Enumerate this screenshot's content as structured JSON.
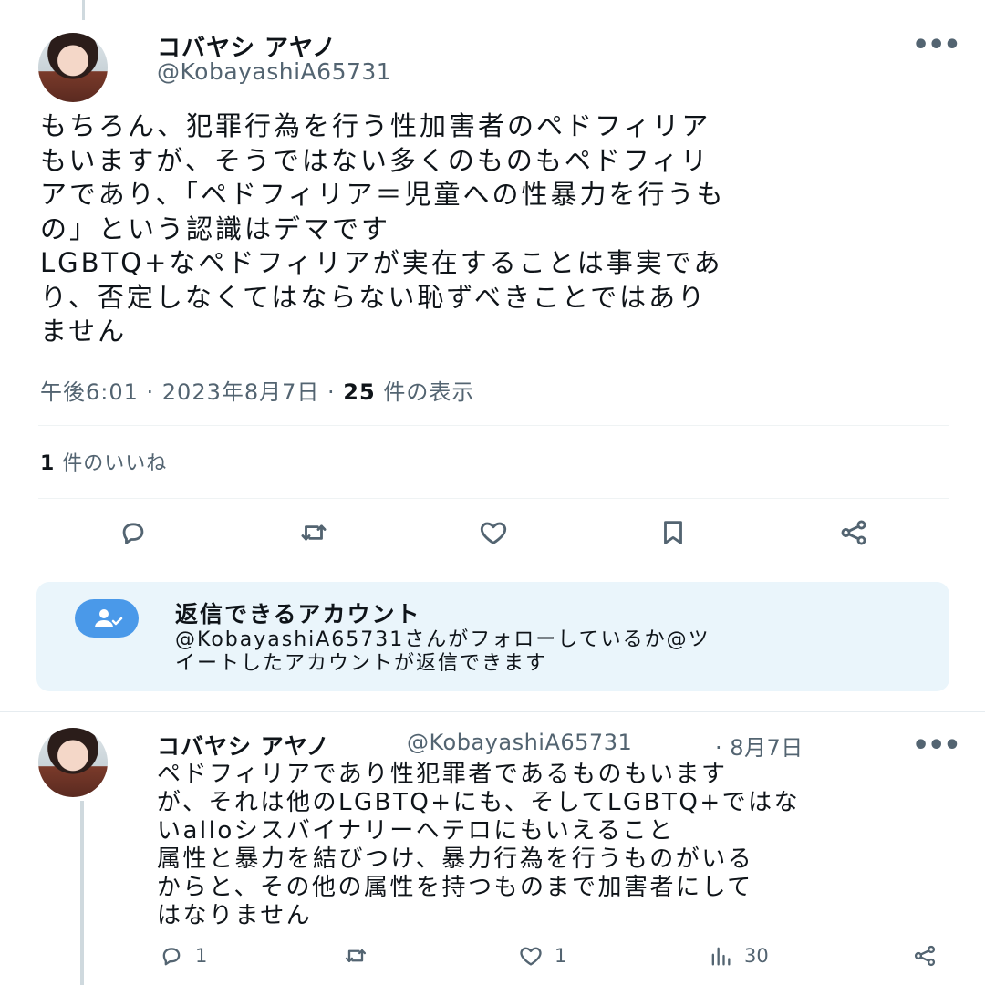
{
  "tweet": {
    "author_name": "コバヤシ アヤノ",
    "author_handle": "@KobayashiA65731",
    "more_label": "•••",
    "text": "もちろん、犯罪行為を行う性加害者のペドフィリア\nもいますが、そうではない多くのものもペドフィリ\nアであり、「ペドフィリア＝児童への性暴力を行うも\nの」という認識はデマです\nLGBTQ+なペドフィリアが実在することは事実であ\nり、否定しなくてはならない恥ずべきことではあり\nません",
    "time": "午後6:01 · 2023年8月7日 · ",
    "views_count": "25",
    "views_label": " 件の表示",
    "likes_count": "1",
    "likes_label": " 件のいいね"
  },
  "actions": {
    "reply": "reply-icon",
    "retweet": "retweet-icon",
    "like": "heart-icon",
    "bookmark": "bookmark-icon",
    "share": "share-icon"
  },
  "reply_notice": {
    "title": "返信できるアカウント",
    "body": "@KobayashiA65731さんがフォローしているか@ツ\nイートしたアカウントが返信できます"
  },
  "reply": {
    "author_name": "コバヤシ アヤノ",
    "author_handle": "@KobayashiA65731",
    "date": "· 8月7日",
    "more_label": "•••",
    "text": "ペドフィリアであり性犯罪者であるものもいます\nが、それは他のLGBTQ+にも、そしてLGBTQ+ではな\nいalloシスバイナリーヘテロにもいえること\n属性と暴力を結びつけ、暴力行為を行うものがいる\nからと、その他の属性を持つものまで加害者にして\nはなりません",
    "reply_count": "1",
    "retweet_count": "",
    "like_count": "1",
    "view_count": "30"
  },
  "colors": {
    "accent": "#1d9bf0",
    "notice_bg": "#eaf5fb",
    "notice_icon": "#4a99e9",
    "muted": "#536471"
  }
}
